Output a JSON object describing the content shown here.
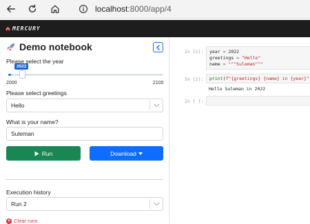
{
  "browser": {
    "url_host": "localhost",
    "url_path": ":8000/app/4"
  },
  "app": {
    "brand": "MERCURY"
  },
  "sidebar": {
    "title": "Demo notebook",
    "year_label": "Please select the year",
    "year_value": "2022",
    "year_min": "2000",
    "year_max": "2100",
    "year_fraction": 0.22,
    "greetings_label": "Please select greetings",
    "greetings_value": "Hello",
    "name_label": "What is your name?",
    "name_value": "Suleman",
    "run_label": "Run",
    "download_label": "Download",
    "history_label": "Execution history",
    "history_value": "Run 2",
    "clear_label": "Clear runs"
  },
  "notebook": {
    "cell1_prompt": "In [1]:",
    "cell2_prompt": "In [2]:",
    "cell2_output": "Hello Suleman in 2022",
    "cell3_prompt": "In [ ]:"
  },
  "colors": {
    "run": "#198754",
    "download": "#0d6efd",
    "header": "#1d1d1d"
  }
}
